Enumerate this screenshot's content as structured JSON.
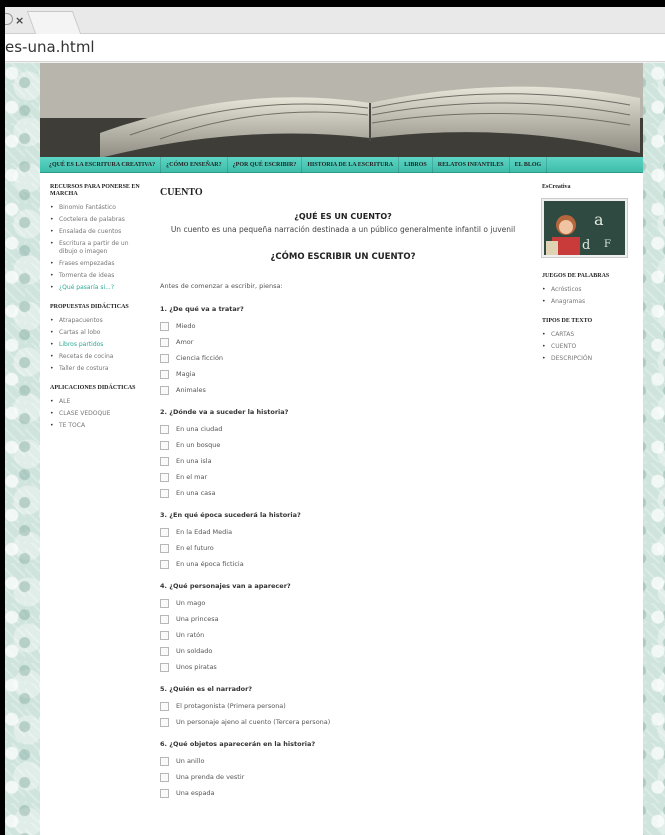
{
  "browser": {
    "tab_close": "×",
    "url": "es-una.html"
  },
  "nav": [
    "¿QUÉ ES LA ESCRITURA CREATIVA?",
    "¿CÓMO ENSEÑAR?",
    "¿POR QUÉ ESCRIBIR?",
    "HISTORIA DE LA ESCRITURA",
    "LIBROS",
    "RELATOS INFANTILES",
    "EL BLOG"
  ],
  "left_sidebar": {
    "recursos": {
      "title": "RECURSOS PARA PONERSE EN MARCHA",
      "items": [
        "Binomio Fantástico",
        "Coctelera de palabras",
        "Ensalada de cuentos",
        "Escritura a partir de un dibujo o imagen",
        "Frases empezadas",
        "Tormenta de ideas",
        "¿Qué pasaría si...?"
      ]
    },
    "propuestas": {
      "title": "PROPUESTAS DIDÁCTICAS",
      "items": [
        "Atrapacuentos",
        "Cartas al lobo",
        "Libros partidos",
        "Recetas de cocina",
        "Taller de costura"
      ]
    },
    "aplicaciones": {
      "title": "APLICACIONES DIDÁCTICAS",
      "items": [
        "ALE",
        "CLASE VEDOQUE",
        "TE TOCA"
      ]
    }
  },
  "main": {
    "title": "CUENTO",
    "what_heading": "¿QUÉ ES UN CUENTO?",
    "intro": "Un cuento es una pequeña narración destinada a un público generalmente infantil o juvenil",
    "how_heading": "¿CÓMO ESCRIBIR UN CUENTO?",
    "pre": "Antes de comenzar a escribir, piensa:",
    "sections": [
      {
        "title": "1. ¿De qué va a tratar?",
        "options": [
          "Miedo",
          "Amor",
          "Ciencia ficción",
          "Magia",
          "Animales"
        ]
      },
      {
        "title": "2. ¿Dónde va a suceder la historia?",
        "options": [
          "En una ciudad",
          "En un bosque",
          "En una isla",
          "En el mar",
          "En una casa"
        ]
      },
      {
        "title": "3. ¿En qué época sucederá la historia?",
        "options": [
          "En la Edad Media",
          "En el futuro",
          "En una época ficticia"
        ]
      },
      {
        "title": "4. ¿Qué personajes van a aparecer?",
        "options": [
          "Un mago",
          "Una princesa",
          "Un ratón",
          "Un soldado",
          "Unos piratas"
        ]
      },
      {
        "title": "5. ¿Quién es el narrador?",
        "options": [
          "El protagonista (Primera persona)",
          "Un personaje ajeno al cuento (Tercera persona)"
        ]
      },
      {
        "title": "6. ¿Qué objetos aparecerán en la historia?",
        "options": [
          "Un anillo",
          "Una prenda de vestir",
          "Una espada"
        ]
      }
    ]
  },
  "right_sidebar": {
    "escreativa": "EsCreativa",
    "juegos": {
      "title": "JUEGOS DE PALABRAS",
      "items": [
        "Acrósticos",
        "Anagramas"
      ]
    },
    "tipos": {
      "title": "TIPOS DE TEXTO",
      "items": [
        "CARTAS",
        "CUENTO",
        "DESCRIPCIÓN"
      ]
    }
  },
  "colors": {
    "nav_accent": "#3fbdaa",
    "link_teal": "#2aa895"
  }
}
